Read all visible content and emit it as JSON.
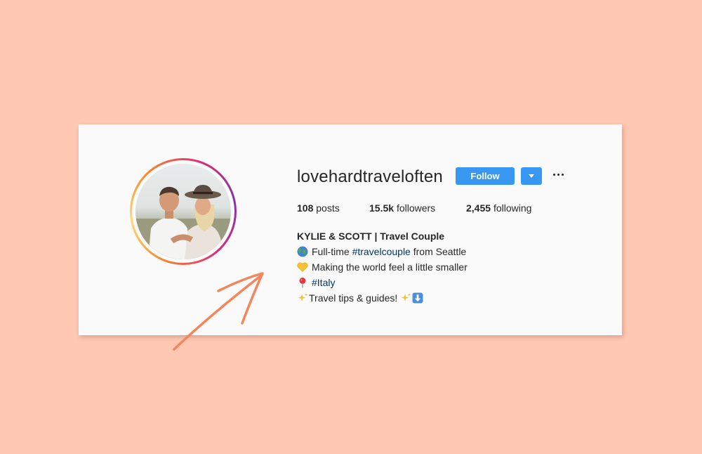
{
  "profile": {
    "username": "lovehardtraveloften",
    "follow_label": "Follow",
    "stats": {
      "posts_count": "108",
      "posts_label": "posts",
      "followers_count": "15.5k",
      "followers_label": "followers",
      "following_count": "2,455",
      "following_label": "following"
    },
    "bio": {
      "name": "KYLIE & SCOTT | Travel Couple",
      "line1_emoji": "globe-icon",
      "line1_pre": "Full-time ",
      "line1_tag": "#travelcouple",
      "line1_post": " from Seattle",
      "line2_emoji": "yellow-heart-icon",
      "line2_text": "Making the world feel a little smaller",
      "line3_emoji": "pin-icon",
      "line3_tag": "#Italy",
      "line4_text": "Travel tips & guides! "
    }
  },
  "colors": {
    "background": "#ffc8b2",
    "card": "#fafafa",
    "button": "#3897f0",
    "hashtag": "#003569",
    "arrow": "#f2865c"
  }
}
